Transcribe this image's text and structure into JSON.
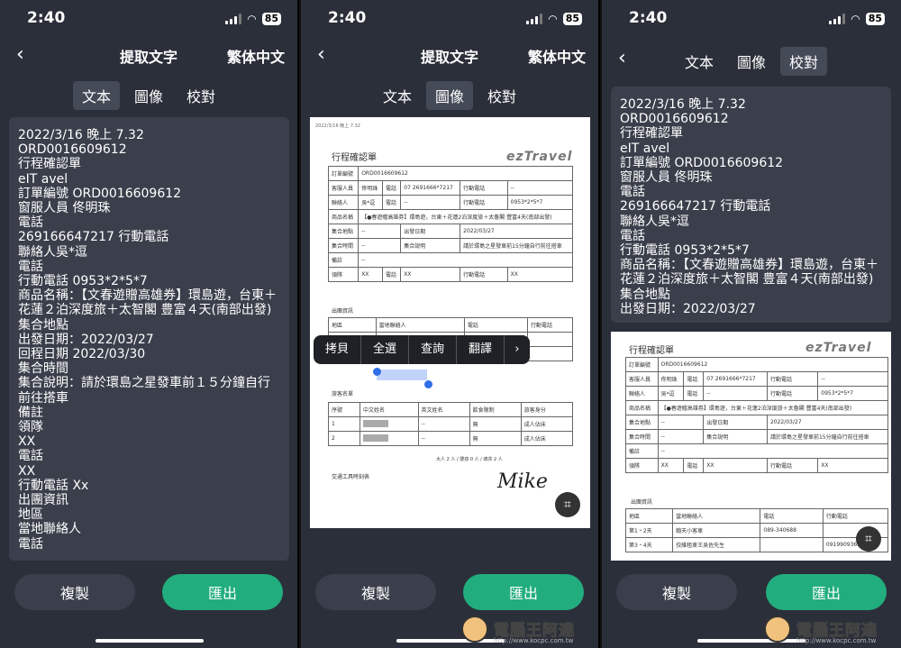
{
  "status": {
    "time": "2:40",
    "battery": "85"
  },
  "phone1": {
    "title": "提取文字",
    "lang": "繁体中文",
    "tabs": [
      "文本",
      "圖像",
      "校對"
    ],
    "text": "2022/3/16 晚上 7.32\nORD0016609612\n行程確認單\neIT avel\n訂單編號 ORD0016609612\n窗服人員 佟明珠\n電話\n269166647217 行動電話\n聯絡人吳*逗\n電話\n行動電話 0953*2*5*7\n商品名稱：【文春遊贈高雄券】環島遊，台東＋花蓮２泊深度旅＋太智閣 豊富４天(南部出發)\n集合地點\n出發日期：2022/03/27\n回程日期 2022/03/30\n集合時間\n集合說明：請於環島之星發車前１５分鐘自行前往搭車\n備註\n領隊\nXX\n電話\nXX\n行動電話 Xx\n出團資訊\n地區\n當地聯絡人\n電話",
    "copy": "複製",
    "export": "匯出"
  },
  "phone2": {
    "title": "提取文字",
    "lang": "繁体中文",
    "tabs": [
      "文本",
      "圖像",
      "校對"
    ],
    "menu": [
      "拷貝",
      "全選",
      "查詢",
      "翻譯",
      "›"
    ],
    "copy": "複製",
    "export": "匯出"
  },
  "phone3": {
    "tabs": [
      "文本",
      "圖像",
      "校對"
    ],
    "text": "2022/3/16 晚上 7.32\nORD0016609612\n行程確認單\neIT avel\n訂單編號 ORD0016609612\n窗服人員 佟明珠\n電話\n269166647217 行動電話\n聯絡人吳*逗\n電話\n行動電話 0953*2*5*7\n商品名稱：【文春遊贈高雄券】環島遊，台東＋花蓮２泊深度旅＋太智閣 豊富４天(南部出發)\n集合地點\n出發日期：2022/03/27",
    "copy": "複製",
    "export": "匯出"
  },
  "doc": {
    "header": "2022/3/16 晚上 7.32",
    "title": "行程確認單",
    "logo": "ezTravel",
    "order_no": "ORD0016609612",
    "staff": "佟明珠",
    "phone": "07 2691666*7217",
    "contact": "吳*逗",
    "mobile": "0953*2*5*7",
    "product": "【●春遊贈高雄券】環島遊，台東＋花蓮2泊深度旅＋太魯閣 豐富4天(南部出發)",
    "depart": "2022/03/27",
    "return": "2022/03/30",
    "note": "請於環島之星發車前15分鐘自行前往搭車",
    "leader": "XX",
    "section_tour": "出團資訊",
    "section_guest": "旅客名單",
    "signature": "Mike",
    "labels": {
      "order": "訂單編號",
      "staff": "客服人員",
      "tel": "電話",
      "mobile": "行動電話",
      "contact": "聯絡人",
      "product": "商品名稱",
      "place": "集合地點",
      "depart": "出發日期",
      "time": "集合時間",
      "explain": "集合說明",
      "remark": "備註",
      "leader": "領隊",
      "return": "回程日期",
      "area": "地區",
      "local": "當地聯絡人"
    },
    "guest_headers": [
      "序號",
      "中文姓名",
      "英文姓名",
      "飲食限制",
      "旅客身分"
    ],
    "guests": [
      [
        "1",
        "",
        "--",
        "無",
        "成人佔床"
      ],
      [
        "2",
        "",
        "--",
        "無",
        "成人佔床"
      ]
    ],
    "total": "大人 2 人 / 嬰孩 0 人 / 總共 2 人",
    "tour_rows": [
      [
        "第1・2天",
        "翰天小客車",
        "089-340688",
        ""
      ],
      [
        "第3・4天",
        "佼維租車王吳佐先生",
        "",
        "0919909369"
      ]
    ],
    "transport": "交通工具時刻表"
  },
  "watermark": {
    "name": "電腦王阿達",
    "url": "http://www.kocpc.com.tw"
  }
}
